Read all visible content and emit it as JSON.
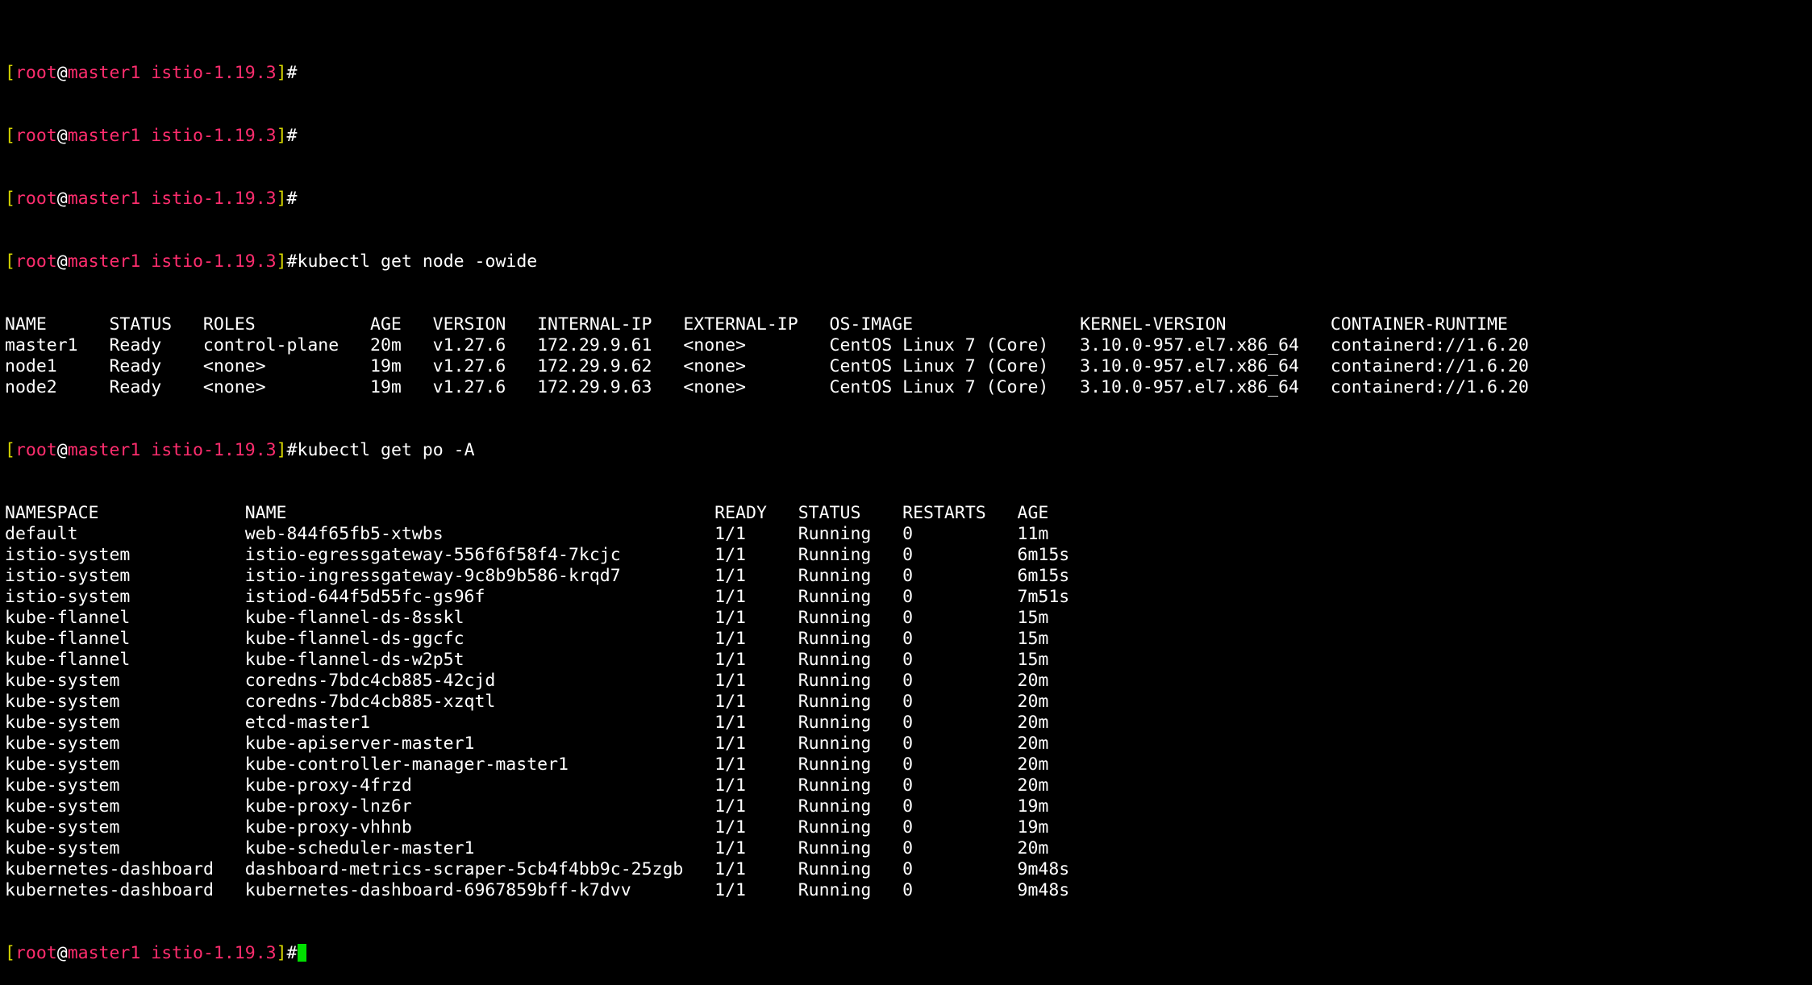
{
  "prompt": {
    "open": "[",
    "user": "root",
    "at": "@",
    "host": "master1",
    "dir": "istio-1.19.3",
    "close": "]",
    "hash": "#"
  },
  "commands": {
    "get_node": "kubectl get node -owide",
    "get_po": "kubectl get po -A"
  },
  "nodes": {
    "headers": [
      "NAME",
      "STATUS",
      "ROLES",
      "AGE",
      "VERSION",
      "INTERNAL-IP",
      "EXTERNAL-IP",
      "OS-IMAGE",
      "KERNEL-VERSION",
      "CONTAINER-RUNTIME"
    ],
    "rows": [
      [
        "master1",
        "Ready",
        "control-plane",
        "20m",
        "v1.27.6",
        "172.29.9.61",
        "<none>",
        "CentOS Linux 7 (Core)",
        "3.10.0-957.el7.x86_64",
        "containerd://1.6.20"
      ],
      [
        "node1",
        "Ready",
        "<none>",
        "19m",
        "v1.27.6",
        "172.29.9.62",
        "<none>",
        "CentOS Linux 7 (Core)",
        "3.10.0-957.el7.x86_64",
        "containerd://1.6.20"
      ],
      [
        "node2",
        "Ready",
        "<none>",
        "19m",
        "v1.27.6",
        "172.29.9.63",
        "<none>",
        "CentOS Linux 7 (Core)",
        "3.10.0-957.el7.x86_64",
        "containerd://1.6.20"
      ]
    ]
  },
  "pods": {
    "headers": [
      "NAMESPACE",
      "NAME",
      "READY",
      "STATUS",
      "RESTARTS",
      "AGE"
    ],
    "rows": [
      [
        "default",
        "web-844f65fb5-xtwbs",
        "1/1",
        "Running",
        "0",
        "11m"
      ],
      [
        "istio-system",
        "istio-egressgateway-556f6f58f4-7kcjc",
        "1/1",
        "Running",
        "0",
        "6m15s"
      ],
      [
        "istio-system",
        "istio-ingressgateway-9c8b9b586-krqd7",
        "1/1",
        "Running",
        "0",
        "6m15s"
      ],
      [
        "istio-system",
        "istiod-644f5d55fc-gs96f",
        "1/1",
        "Running",
        "0",
        "7m51s"
      ],
      [
        "kube-flannel",
        "kube-flannel-ds-8sskl",
        "1/1",
        "Running",
        "0",
        "15m"
      ],
      [
        "kube-flannel",
        "kube-flannel-ds-ggcfc",
        "1/1",
        "Running",
        "0",
        "15m"
      ],
      [
        "kube-flannel",
        "kube-flannel-ds-w2p5t",
        "1/1",
        "Running",
        "0",
        "15m"
      ],
      [
        "kube-system",
        "coredns-7bdc4cb885-42cjd",
        "1/1",
        "Running",
        "0",
        "20m"
      ],
      [
        "kube-system",
        "coredns-7bdc4cb885-xzqtl",
        "1/1",
        "Running",
        "0",
        "20m"
      ],
      [
        "kube-system",
        "etcd-master1",
        "1/1",
        "Running",
        "0",
        "20m"
      ],
      [
        "kube-system",
        "kube-apiserver-master1",
        "1/1",
        "Running",
        "0",
        "20m"
      ],
      [
        "kube-system",
        "kube-controller-manager-master1",
        "1/1",
        "Running",
        "0",
        "20m"
      ],
      [
        "kube-system",
        "kube-proxy-4frzd",
        "1/1",
        "Running",
        "0",
        "20m"
      ],
      [
        "kube-system",
        "kube-proxy-lnz6r",
        "1/1",
        "Running",
        "0",
        "19m"
      ],
      [
        "kube-system",
        "kube-proxy-vhhnb",
        "1/1",
        "Running",
        "0",
        "19m"
      ],
      [
        "kube-system",
        "kube-scheduler-master1",
        "1/1",
        "Running",
        "0",
        "20m"
      ],
      [
        "kubernetes-dashboard",
        "dashboard-metrics-scraper-5cb4f4bb9c-25zgb",
        "1/1",
        "Running",
        "0",
        "9m48s"
      ],
      [
        "kubernetes-dashboard",
        "kubernetes-dashboard-6967859bff-k7dvv",
        "1/1",
        "Running",
        "0",
        "9m48s"
      ]
    ]
  },
  "colors": {
    "background": "#000000",
    "text": "#ffffff",
    "prompt_accent": "#ff2d6e",
    "bracket": "#d6d600",
    "cursor": "#00e000"
  }
}
